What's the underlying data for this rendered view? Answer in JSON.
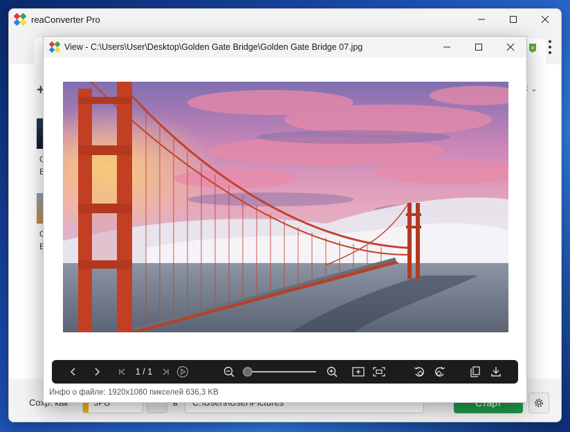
{
  "main_window": {
    "title": "reaConverter Pro",
    "footer": {
      "save_as_label": "Сохр. как",
      "format_value": "JPG",
      "in_label": "в",
      "output_path": "C:\\Users\\User\\Pictures",
      "start_label": "Старт"
    },
    "thumbnail_labels": [
      "G",
      "B",
      "G",
      "B"
    ],
    "brand_colors": {
      "green": "#1e9a4a",
      "accent_yellow": "#f0b400"
    }
  },
  "viewer": {
    "title": "View - C:\\Users\\User\\Desktop\\Golden Gate Bridge\\Golden Gate Bridge 07.jpg",
    "page_counter": "1 / 1",
    "file_info": "Инфо о файле: 1920x1080 пикселей 636,3 KB",
    "zoom_level": 0.05,
    "toolbar_icons": [
      "chevron-left-icon",
      "chevron-right-icon",
      "first-page-icon",
      "last-page-icon",
      "play-icon",
      "zoom-out-icon",
      "zoom-in-icon",
      "fit-to-window-icon",
      "actual-size-icon",
      "rotate-left-icon",
      "rotate-right-icon",
      "copy-icon",
      "download-icon"
    ]
  }
}
